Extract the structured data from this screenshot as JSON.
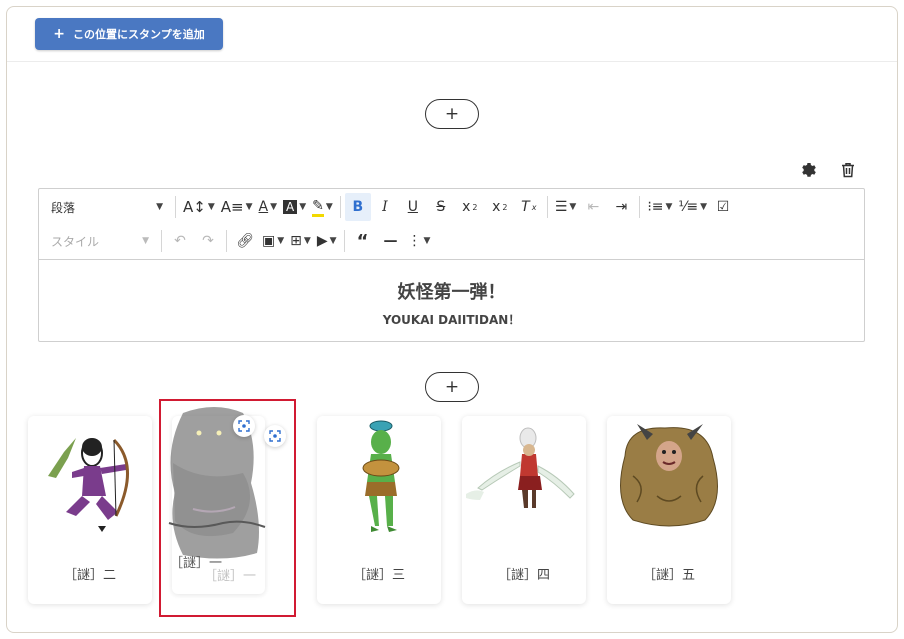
{
  "header": {
    "add_stamp_label": "この位置にスタンプを追加"
  },
  "block_controls": {
    "settings_icon": "gear-icon",
    "delete_icon": "trash-icon"
  },
  "add_block": {
    "label": "+"
  },
  "toolbar": {
    "paragraph_select": "段落",
    "style_select": "スタイル",
    "bold": "B",
    "italic": "I",
    "underline": "U",
    "strike": "S"
  },
  "editor": {
    "heading": "妖怪第一弾！",
    "subheading": "YOUKAI DAIITIDAN！"
  },
  "cards": [
    {
      "label": "［謎］二",
      "icon": "archer-youkai"
    },
    {
      "label": "［謎］一",
      "icon": "shadow-youkai"
    },
    {
      "label": "［謎］三",
      "icon": "green-goblin-youkai"
    },
    {
      "label": "［謎］四",
      "icon": "samurai-youkai"
    },
    {
      "label": "［謎］五",
      "icon": "furry-youkai"
    }
  ],
  "drag_ghost": {
    "label": "［謎］一",
    "label_shadow": "［謎］一"
  },
  "colors": {
    "primary": "#4a78c2",
    "highlight": "#d11a32",
    "active": "#2f6fcf"
  }
}
